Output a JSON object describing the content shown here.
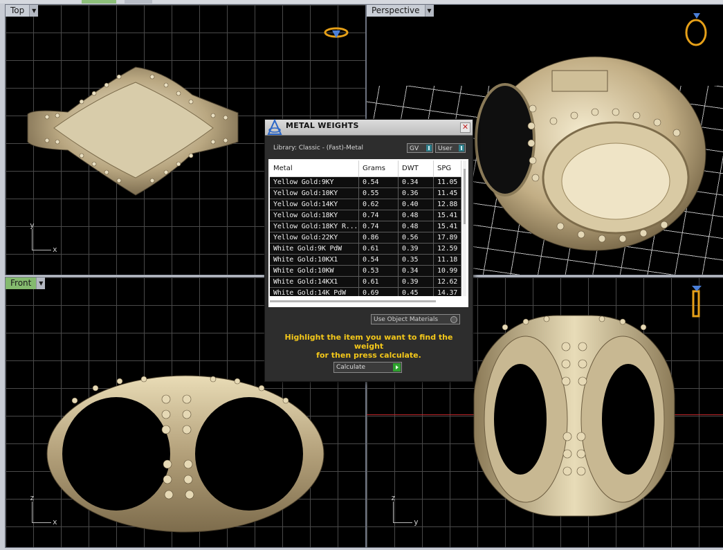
{
  "viewports": {
    "top": {
      "label": "Top",
      "axis_v": "y",
      "axis_h": "x"
    },
    "perspective": {
      "label": "Perspective"
    },
    "front": {
      "label": "Front",
      "axis_v": "z",
      "axis_h": "x"
    },
    "right": {
      "axis_v": "z",
      "axis_h": "y"
    }
  },
  "dialog": {
    "title": "METAL WEIGHTS",
    "library": "Library: Classic - (Fast)-Metal",
    "combo_gv": "GV",
    "combo_user": "User",
    "columns": [
      "Metal",
      "Grams",
      "DWT",
      "SPG"
    ],
    "rows": [
      [
        "Yellow Gold:9KY",
        "0.54",
        "0.34",
        "11.05"
      ],
      [
        "Yellow Gold:10KY",
        "0.55",
        "0.36",
        "11.45"
      ],
      [
        "Yellow Gold:14KY",
        "0.62",
        "0.40",
        "12.88"
      ],
      [
        "Yellow Gold:18KY",
        "0.74",
        "0.48",
        "15.41"
      ],
      [
        "Yellow Gold:18KY R...",
        "0.74",
        "0.48",
        "15.41"
      ],
      [
        "Yellow Gold:22KY",
        "0.86",
        "0.56",
        "17.89"
      ],
      [
        "White Gold:9K PdW",
        "0.61",
        "0.39",
        "12.59"
      ],
      [
        "White Gold:10KX1",
        "0.54",
        "0.35",
        "11.18"
      ],
      [
        "White Gold:10KW",
        "0.53",
        "0.34",
        "10.99"
      ],
      [
        "White Gold:14KX1",
        "0.61",
        "0.39",
        "12.62"
      ],
      [
        "White Gold:14K PdW",
        "0.69",
        "0.45",
        "14.37"
      ]
    ],
    "use_object_materials": "Use Object Materials",
    "hint_line1": "Highlight the item you want to find the weight",
    "hint_line2": "for then press calculate.",
    "calculate": "Calculate"
  },
  "colors": {
    "hint_yellow": "#f4c81a",
    "active_viewport_label": "#84ba6e",
    "gold": "#cbb98c"
  }
}
